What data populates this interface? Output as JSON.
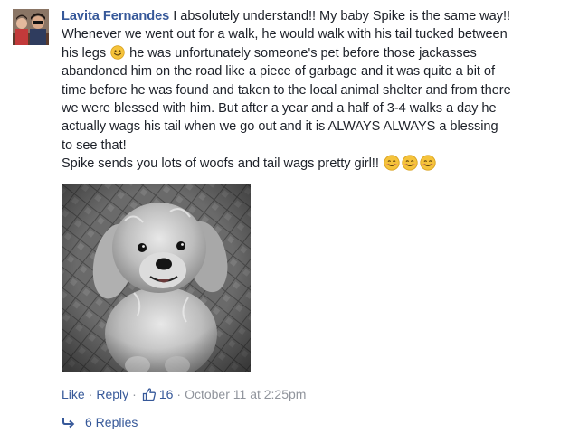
{
  "comment": {
    "author": "Lavita Fernandes",
    "lines": [
      "I absolutely understand!! My baby Spike is the same way!!",
      "Whenever we went out for a walk, he would walk with his tail tucked between",
      "his legs",
      "he was unfortunately someone's pet before those jackasses",
      "abandoned him on the road like a piece of garbage and it was quite a bit of",
      "time before he was found and taken to the local animal shelter and from there",
      "we were blessed with him. But after a year and a half of 3-4 walks a day he",
      "actually wags his tail when we go out and it is ALWAYS ALWAYS a blessing",
      "to see that!",
      "Spike sends you lots of woofs and tail wags pretty girl!!"
    ],
    "emoji_icon": "smiley-emoji-icon",
    "photo_icon": "dog-photo"
  },
  "actions": {
    "like": "Like",
    "separator": "·",
    "reply": "Reply",
    "like_count": "16",
    "timestamp": "October 11 at 2:25pm"
  },
  "replies": {
    "label": "6 Replies"
  },
  "colors": {
    "link": "#365899",
    "meta": "#90949c",
    "text": "#1d2129",
    "emoji": "#f5c33b"
  }
}
